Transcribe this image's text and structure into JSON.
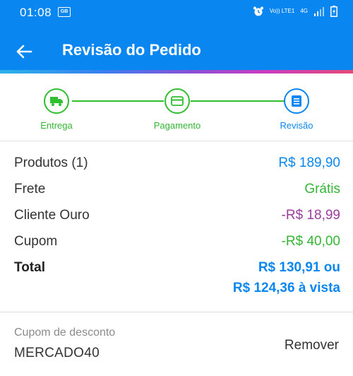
{
  "status_bar": {
    "time": "01:08",
    "notification_text": "GB",
    "volte_text": "Vo)) LTE1",
    "network_text": "4G"
  },
  "header": {
    "title": "Revisão do Pedido",
    "back_icon": "arrow-left-icon",
    "color": "#0a86f0"
  },
  "stepper": {
    "steps": [
      {
        "label": "Entrega",
        "icon": "truck-icon",
        "state": "done"
      },
      {
        "label": "Pagamento",
        "icon": "credit-card-icon",
        "state": "done"
      },
      {
        "label": "Revisão",
        "icon": "document-list-icon",
        "state": "active"
      }
    ],
    "done_color": "#2fbf2f",
    "active_color": "#0a86f0"
  },
  "summary": {
    "products_label": "Produtos (1)",
    "products_value": "R$ 189,90",
    "shipping_label": "Frete",
    "shipping_value": "Grátis",
    "gold_label": "Cliente Ouro",
    "gold_value": "-R$ 18,99",
    "coupon_label": "Cupom",
    "coupon_value": "-R$ 40,00",
    "total_label": "Total",
    "total_value_line1": "R$ 130,91 ou",
    "total_value_line2": "R$ 124,36 à vista"
  },
  "coupon": {
    "label": "Cupom de desconto",
    "code": "MERCADO40",
    "remove_label": "Remover"
  }
}
